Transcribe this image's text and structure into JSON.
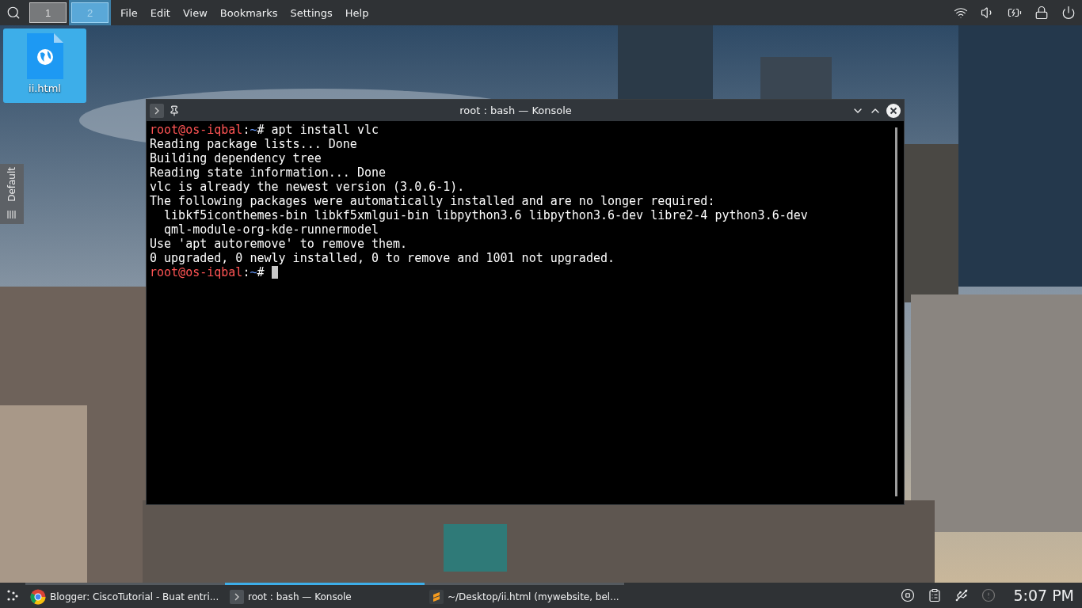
{
  "top_bar": {
    "desktops": [
      {
        "label": "1",
        "selected": false
      },
      {
        "label": "2",
        "selected": true
      }
    ],
    "menu": [
      "File",
      "Edit",
      "View",
      "Bookmarks",
      "Settings",
      "Help"
    ]
  },
  "desktop_icons": [
    {
      "label": "ii.html",
      "selected": true
    }
  ],
  "panel_tab": {
    "label": "Default"
  },
  "window": {
    "title": "root : bash — Konsole",
    "lines": [
      {
        "kind": "prompt",
        "user": "root@os-iqbal",
        "separator": ":",
        "path": "~",
        "command": "# apt install vlc",
        "cursor": false
      },
      {
        "kind": "output",
        "text": "Reading package lists... Done"
      },
      {
        "kind": "output",
        "text": "Building dependency tree"
      },
      {
        "kind": "output",
        "text": "Reading state information... Done"
      },
      {
        "kind": "output",
        "text": "vlc is already the newest version (3.0.6-1)."
      },
      {
        "kind": "output",
        "text": "The following packages were automatically installed and are no longer required:"
      },
      {
        "kind": "output",
        "text": "  libkf5iconthemes-bin libkf5xmlgui-bin libpython3.6 libpython3.6-dev libre2-4 python3.6-dev"
      },
      {
        "kind": "output",
        "text": "  qml-module-org-kde-runnermodel"
      },
      {
        "kind": "output",
        "text": "Use 'apt autoremove' to remove them."
      },
      {
        "kind": "output",
        "text": "0 upgraded, 0 newly installed, 0 to remove and 1001 not upgraded."
      },
      {
        "kind": "prompt",
        "user": "root@os-iqbal",
        "separator": ":",
        "path": "~",
        "command": "# ",
        "cursor": true
      }
    ]
  },
  "taskbar": {
    "tasks": [
      {
        "kind": "chrome",
        "label": "Blogger: CiscoTutorial - Buat entri...",
        "selected": false
      },
      {
        "kind": "terminal",
        "label": "root : bash — Konsole",
        "selected": true
      },
      {
        "kind": "sublime",
        "label": "~/Desktop/ii.html (mywebsite, bel...",
        "selected": false
      }
    ],
    "clock": "5:07 PM"
  }
}
